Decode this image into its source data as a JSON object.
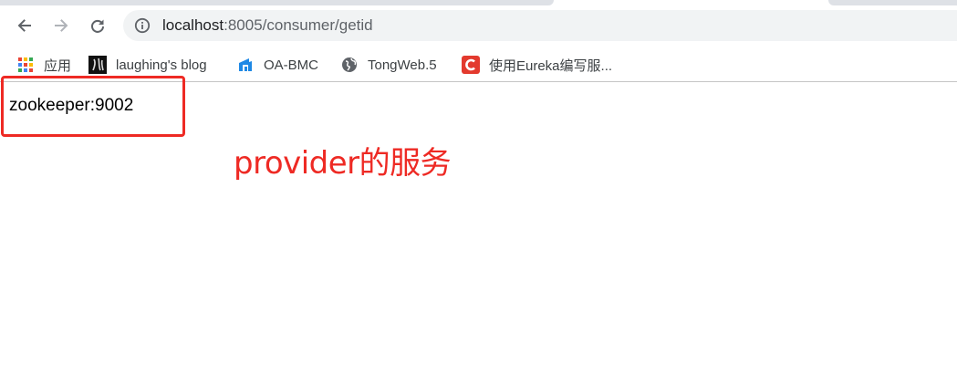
{
  "browser": {
    "address": {
      "host": "localhost",
      "path": ":8005/consumer/getid"
    },
    "bookmarks": [
      {
        "label": "应用",
        "icon": "apps-grid-icon"
      },
      {
        "label": "laughing's blog",
        "icon": "blog-avatar-icon"
      },
      {
        "label": "OA-BMC",
        "icon": "oa-bmc-icon"
      },
      {
        "label": "TongWeb.5",
        "icon": "globe-icon"
      },
      {
        "label": "使用Eureka编写服...",
        "icon": "csdn-icon"
      }
    ]
  },
  "page": {
    "result": "zookeeper:9002"
  },
  "annotation": {
    "text": "provider的服务",
    "color": "#ee2a24"
  }
}
